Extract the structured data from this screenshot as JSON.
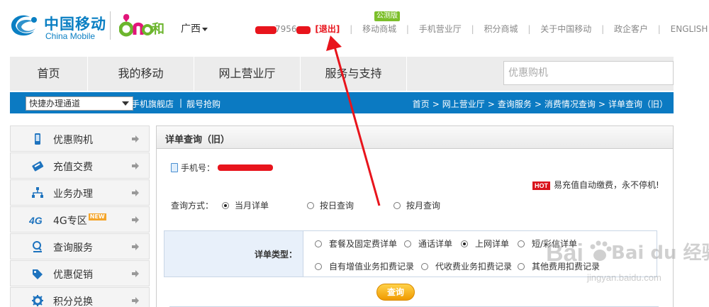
{
  "header": {
    "logo_cn": "中国移动",
    "logo_en": "China Mobile",
    "brand_text": "和",
    "region": "广西",
    "phone_visible": "7956",
    "logout": "[退出]",
    "badge_gongce": "公测版",
    "links": [
      "移动商城",
      "手机营业厅",
      "积分商城",
      "关于中国移动",
      "政企客户",
      "ENGLISH"
    ]
  },
  "mainnav": {
    "items": [
      "首页",
      "我的移动",
      "网上营业厅",
      "服务与支持"
    ],
    "search_placeholder": "优惠购机"
  },
  "bluebar": {
    "quick_select": "快捷办理通道",
    "link1": "手机旗舰店",
    "link2": "靓号抢购",
    "breadcrumb": [
      "首页",
      "网上营业厅",
      "查询服务",
      "消费情况查询",
      "详单查询（旧）"
    ]
  },
  "sidebar": {
    "items": [
      {
        "label": "优惠购机",
        "icon": "phone-icon"
      },
      {
        "label": "充值交费",
        "icon": "card-icon"
      },
      {
        "label": "业务办理",
        "icon": "network-icon"
      },
      {
        "label": "4G专区",
        "icon": "4g-icon",
        "badge": "NEW"
      },
      {
        "label": "查询服务",
        "icon": "magnifier-icon"
      },
      {
        "label": "优惠促销",
        "icon": "tag-icon"
      },
      {
        "label": "积分兑换",
        "icon": "gear-icon"
      }
    ]
  },
  "panel": {
    "title": "详单查询（旧）",
    "phone_label": "手机号：",
    "hot": "HOT",
    "promo": "易充值自动缴费，永不停机!",
    "query_mode_label": "查询方式：",
    "modes": [
      "当月详单",
      "按日查询",
      "按月查询"
    ],
    "selected_mode": "当月详单",
    "type_label": "详单类型：",
    "types_row1": [
      "套餐及固定费详单",
      "通话详单",
      "上网详单",
      "短/彩信详单"
    ],
    "types_row2": [
      "自有增值业务扣费记录",
      "代收费业务扣费记录",
      "其他费用扣费记录"
    ],
    "selected_type": "上网详单",
    "query_button": "查询"
  },
  "watermark": {
    "text": "Bai du 经验",
    "url": "jingyan.baidu.com"
  },
  "colors": {
    "brand_blue": "#0a7fc3",
    "bar_blue": "#0b7ac2",
    "annotation_red": "#e8141c",
    "button_orange": "#f09a00"
  }
}
